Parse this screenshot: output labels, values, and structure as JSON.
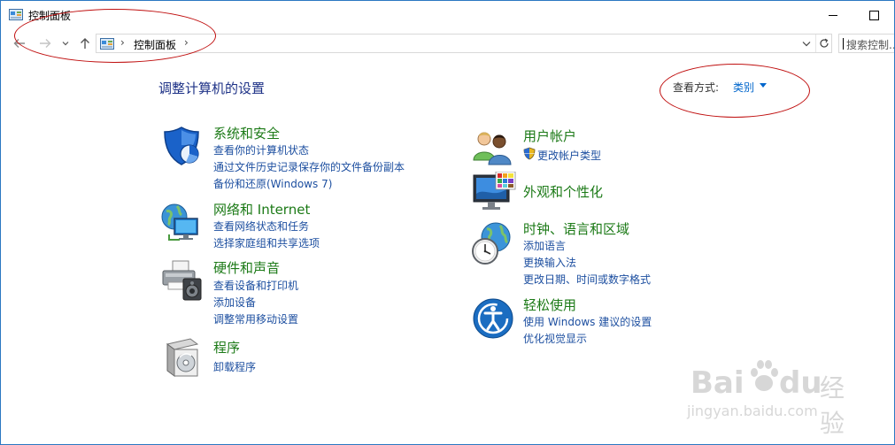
{
  "window": {
    "title": "控制面板"
  },
  "address": {
    "crumb": "控制面板",
    "separator": "›"
  },
  "search": {
    "placeholder": "搜索控制..."
  },
  "page": {
    "title": "调整计算机的设置",
    "view_label": "查看方式:",
    "view_value": "类别"
  },
  "categories": [
    {
      "title": "系统和安全",
      "icon": "shield-icon",
      "links": [
        "查看你的计算机状态",
        "通过文件历史记录保存你的文件备份副本",
        "备份和还原(Windows 7)"
      ]
    },
    {
      "title": "网络和 Internet",
      "icon": "network-globe-icon",
      "links": [
        "查看网络状态和任务",
        "选择家庭组和共享选项"
      ]
    },
    {
      "title": "硬件和声音",
      "icon": "printer-speaker-icon",
      "links": [
        "查看设备和打印机",
        "添加设备",
        "调整常用移动设置"
      ]
    },
    {
      "title": "程序",
      "icon": "programs-disc-icon",
      "links": [
        "卸载程序"
      ]
    },
    {
      "title": "用户帐户",
      "icon": "users-icon",
      "links": [
        "更改帐户类型"
      ]
    },
    {
      "title": "外观和个性化",
      "icon": "monitor-palette-icon",
      "links": []
    },
    {
      "title": "时钟、语言和区域",
      "icon": "clock-globe-icon",
      "links": [
        "添加语言",
        "更换输入法",
        "更改日期、时间或数字格式"
      ]
    },
    {
      "title": "轻松使用",
      "icon": "ease-of-access-icon",
      "links": [
        "使用 Windows 建议的设置",
        "优化视觉显示"
      ]
    }
  ],
  "watermark": {
    "brand": "Bai",
    "brand_end": "du",
    "cn": "经验",
    "url": "jingyan.baidu.com"
  },
  "colors": {
    "link": "#1d4fa0",
    "category_title": "#1c7a17",
    "page_title": "#1e3287",
    "annotation": "#c01010"
  }
}
